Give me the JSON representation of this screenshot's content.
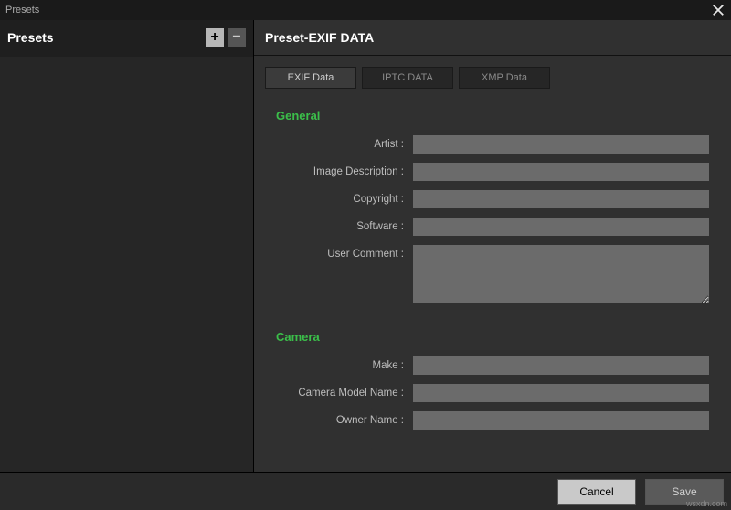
{
  "titlebar": {
    "title": "Presets"
  },
  "sidebar": {
    "heading": "Presets",
    "add_label": "+",
    "remove_label": "−"
  },
  "main": {
    "title": "Preset-EXIF DATA"
  },
  "tabs": [
    {
      "label": "EXIF Data",
      "active": true
    },
    {
      "label": "IPTC DATA",
      "active": false
    },
    {
      "label": "XMP Data",
      "active": false
    }
  ],
  "sections": {
    "general": {
      "title": "General",
      "fields": {
        "artist": "Artist :",
        "image_description": "Image Description :",
        "copyright": "Copyright :",
        "software": "Software :",
        "user_comment": "User Comment :"
      }
    },
    "camera": {
      "title": "Camera",
      "fields": {
        "make": "Make :",
        "camera_model_name": "Camera Model Name :",
        "owner_name": "Owner Name :"
      }
    }
  },
  "footer": {
    "cancel": "Cancel",
    "save": "Save"
  },
  "watermark": "wsxdn.com"
}
